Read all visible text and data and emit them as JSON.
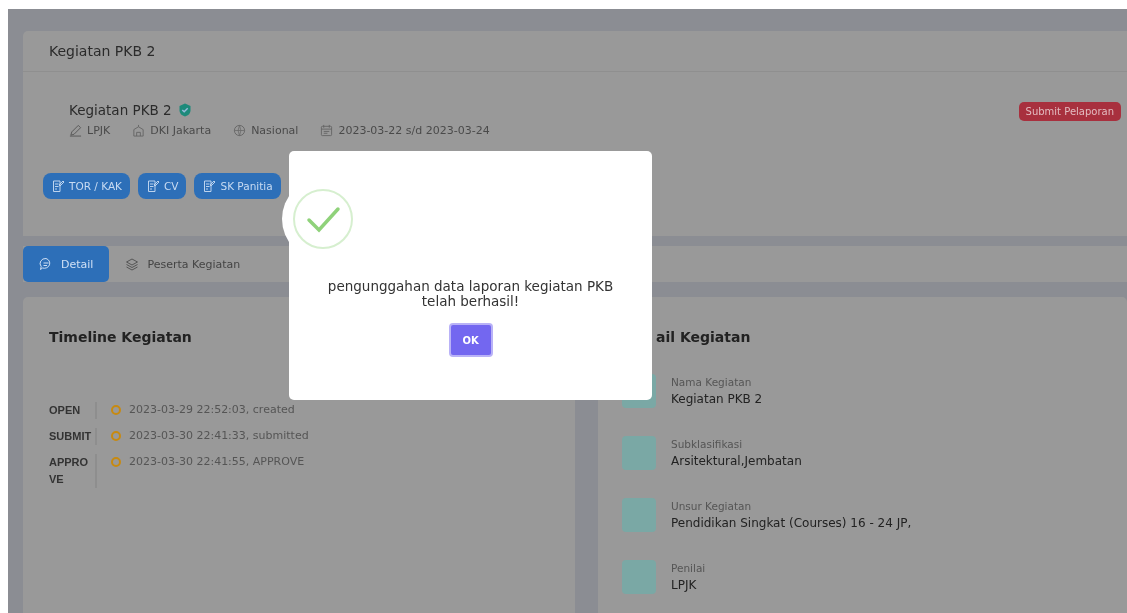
{
  "page_title": "Kegiatan PKB 2",
  "activity": {
    "name": "Kegiatan PKB 2",
    "verified": true,
    "meta": [
      {
        "kind": "organizer",
        "text": "LPJK"
      },
      {
        "kind": "location",
        "text": "DKI Jakarta"
      },
      {
        "kind": "scope",
        "text": "Nasional"
      },
      {
        "kind": "date",
        "text": "2023-03-22 s/d 2023-03-24"
      }
    ],
    "documents": [
      "TOR / KAK",
      "CV",
      "SK Panitia"
    ],
    "submit_button": "Submit Pelaporan"
  },
  "tabs": [
    {
      "label": "Detail",
      "selected": true
    },
    {
      "label": "Peserta Kegiatan",
      "selected": false
    }
  ],
  "timeline": {
    "title": "Timeline Kegiatan",
    "entries": [
      {
        "status": "OPEN",
        "text": "2023-03-29 22:52:03, created"
      },
      {
        "status": "SUBMIT",
        "text": "2023-03-30 22:41:33, submitted"
      },
      {
        "status": "APPROVE",
        "text": "2023-03-30 22:41:55, APPROVE"
      }
    ]
  },
  "detail": {
    "title": "ail Kegiatan",
    "fields": [
      {
        "label": "Nama Kegiatan",
        "value": "Kegiatan PKB 2"
      },
      {
        "label": "Subklasifikasi",
        "value": "Arsitektural,Jembatan"
      },
      {
        "label": "Unsur Kegiatan",
        "value": "Pendidikan Singkat (Courses) 16 - 24 JP,"
      },
      {
        "label": "Penilai",
        "value": "LPJK"
      }
    ]
  },
  "dialog": {
    "message": "pengunggahan data laporan kegiatan PKB telah berhasil!",
    "button": "OK"
  }
}
